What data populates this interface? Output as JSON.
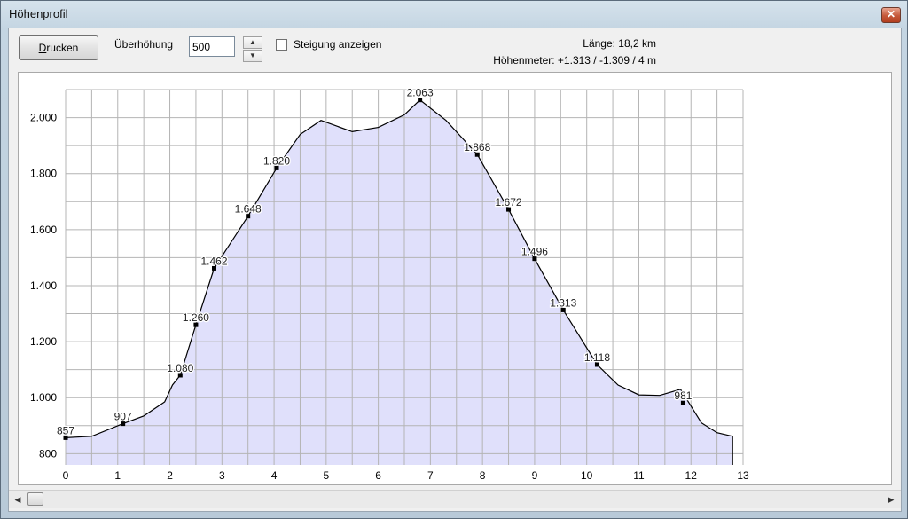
{
  "window": {
    "title": "Höhenprofil",
    "close_glyph": "✕"
  },
  "toolbar": {
    "print_label_key": "D",
    "print_label_rest": "rucken",
    "exaggeration_label": "Überhöhung",
    "exaggeration_value": "500",
    "spin_up_glyph": "▲",
    "spin_down_glyph": "▼",
    "slope_label": "Steigung anzeigen",
    "slope_checked": false,
    "length_text": "Länge: 18,2 km",
    "elevation_text": "Höhenmeter: +1.313 / -1.309 / 4 m"
  },
  "scrollbar": {
    "left_glyph": "◀",
    "right_glyph": "▶"
  },
  "chart_data": {
    "type": "area",
    "fill_color": "#e0e0fb",
    "line_color": "#000000",
    "grid": true,
    "xlim": [
      0,
      13
    ],
    "ylim": [
      760,
      2100
    ],
    "x_ticks": [
      "0",
      "1",
      "2",
      "3",
      "4",
      "5",
      "6",
      "7",
      "8",
      "9",
      "10",
      "11",
      "12",
      "13"
    ],
    "y_ticks": [
      {
        "value": 800,
        "label": "800"
      },
      {
        "value": 1000,
        "label": "1.000"
      },
      {
        "value": 1200,
        "label": "1.200"
      },
      {
        "value": 1400,
        "label": "1.400"
      },
      {
        "value": 1600,
        "label": "1.600"
      },
      {
        "value": 1800,
        "label": "1.800"
      },
      {
        "value": 2000,
        "label": "2.000"
      }
    ],
    "profile": [
      [
        0,
        857
      ],
      [
        0.5,
        862
      ],
      [
        1.1,
        907
      ],
      [
        1.5,
        935
      ],
      [
        1.9,
        985
      ],
      [
        2.05,
        1045
      ],
      [
        2.2,
        1080
      ],
      [
        2.5,
        1260
      ],
      [
        2.85,
        1462
      ],
      [
        3.5,
        1648
      ],
      [
        4.05,
        1820
      ],
      [
        4.5,
        1940
      ],
      [
        4.9,
        1990
      ],
      [
        5.5,
        1950
      ],
      [
        6.0,
        1965
      ],
      [
        6.5,
        2010
      ],
      [
        6.8,
        2063
      ],
      [
        7.3,
        1990
      ],
      [
        7.9,
        1868
      ],
      [
        8.5,
        1672
      ],
      [
        9.0,
        1496
      ],
      [
        9.55,
        1313
      ],
      [
        10.2,
        1118
      ],
      [
        10.6,
        1045
      ],
      [
        11.0,
        1010
      ],
      [
        11.4,
        1008
      ],
      [
        11.8,
        1030
      ],
      [
        12.2,
        910
      ],
      [
        12.5,
        875
      ],
      [
        12.8,
        862
      ],
      [
        12.8,
        760
      ]
    ],
    "markers": [
      {
        "x": 0.0,
        "y": 857,
        "label": "857"
      },
      {
        "x": 1.1,
        "y": 907,
        "label": "907"
      },
      {
        "x": 2.2,
        "y": 1080,
        "label": "1.080"
      },
      {
        "x": 2.5,
        "y": 1260,
        "label": "1.260"
      },
      {
        "x": 2.85,
        "y": 1462,
        "label": "1.462"
      },
      {
        "x": 3.5,
        "y": 1648,
        "label": "1.648"
      },
      {
        "x": 4.05,
        "y": 1820,
        "label": "1.820"
      },
      {
        "x": 6.8,
        "y": 2063,
        "label": "2.063"
      },
      {
        "x": 7.9,
        "y": 1868,
        "label": "1.868"
      },
      {
        "x": 8.5,
        "y": 1672,
        "label": "1.672"
      },
      {
        "x": 9.0,
        "y": 1496,
        "label": "1.496"
      },
      {
        "x": 9.55,
        "y": 1313,
        "label": "1.313"
      },
      {
        "x": 10.2,
        "y": 1118,
        "label": "1.118"
      },
      {
        "x": 11.85,
        "y": 981,
        "label": "981"
      }
    ]
  }
}
